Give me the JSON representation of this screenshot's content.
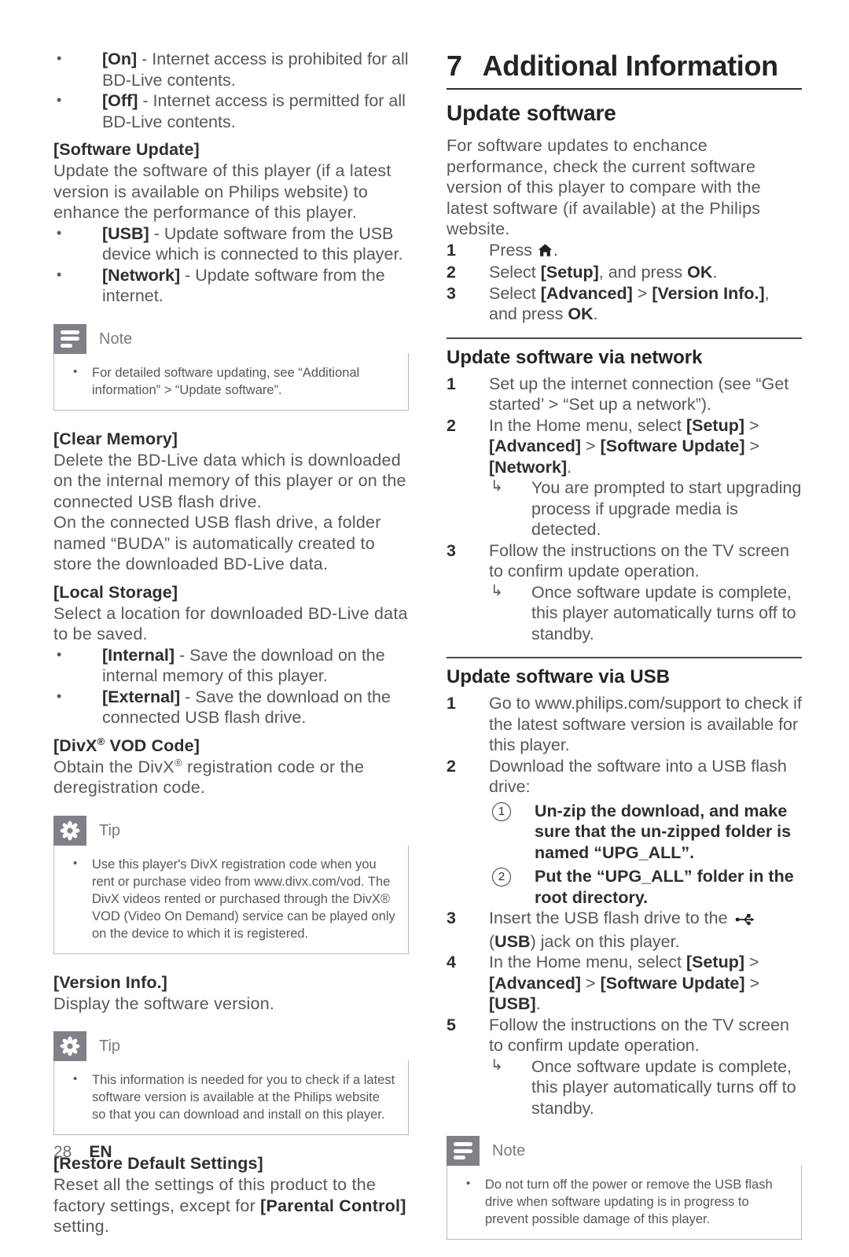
{
  "page": {
    "number": "28",
    "language": "EN"
  },
  "left_column": {
    "bd_live_options": [
      {
        "key": "[On]",
        "text": " - Internet access is prohibited for all BD-Live contents."
      },
      {
        "key": "[Off]",
        "text": " - Internet access is permitted for all BD-Live contents."
      }
    ],
    "software_update": {
      "heading": "[Software Update]",
      "body": "Update the software of this player (if a latest version is available on Philips website) to enhance the performance of this player.",
      "options": [
        {
          "key": "[USB]",
          "text": " - Update software from the USB device which is connected to this player."
        },
        {
          "key": "[Network]",
          "text": " - Update software from the internet."
        }
      ]
    },
    "note1": {
      "title": "Note",
      "icon": "note-lines-icon",
      "items": [
        "For detailed software updating, see “Additional information” > “Update software”."
      ]
    },
    "clear_memory": {
      "heading": "[Clear Memory]",
      "paragraph1": "Delete the BD-Live data which is downloaded on the internal memory of this player or on the connected USB flash drive.",
      "paragraph2": "On the connected USB flash drive, a folder named “BUDA” is automatically created to store the downloaded BD-Live data."
    },
    "local_storage": {
      "heading": "[Local Storage]",
      "body": "Select a location for downloaded BD-Live data to be saved.",
      "options": [
        {
          "key": "[Internal]",
          "text": " - Save the download on the internal memory of this player."
        },
        {
          "key": "[External]",
          "text": " - Save the download on the connected USB flash drive."
        }
      ]
    },
    "divx_vod": {
      "heading_pre": "[DivX",
      "heading_reg": "®",
      "heading_post": " VOD Code]",
      "body_pre": "Obtain the DivX",
      "body_reg": "®",
      "body_post": " registration code or the deregistration code."
    },
    "tip1": {
      "title": "Tip",
      "icon": "tip-asterisk-icon",
      "items": [
        "Use this player's DivX registration code when you rent or purchase video from www.divx.com/vod. The DivX videos rented or purchased through the DivX® VOD (Video On Demand) service can be played only on the device to which it is registered."
      ]
    },
    "version_info": {
      "heading": "[Version Info.]",
      "body": "Display the software version."
    },
    "tip2": {
      "title": "Tip",
      "icon": "tip-asterisk-icon",
      "items": [
        "This information is needed for you to check if a latest software version is available at the Philips website so that you can download and install on this player."
      ]
    },
    "restore_defaults": {
      "heading": "[Restore Default Settings]",
      "body_pre": "Reset all the settings of this product to the factory settings, except for ",
      "body_bold": "[Parental Control]",
      "body_post": " setting."
    }
  },
  "right_column": {
    "chapter": {
      "number": "7",
      "title": "Additional Information"
    },
    "update_software": {
      "heading": "Update software",
      "intro": "For software updates to enchance performance, check the current software version of this player to compare with the latest software (if available) at the Philips website.",
      "steps": [
        {
          "num": "1",
          "pre": "Press ",
          "icon": "home-icon",
          "post": "."
        },
        {
          "num": "2",
          "pre": "Select ",
          "bold1": "[Setup]",
          "mid": ", and press ",
          "bold2": "OK",
          "post": "."
        },
        {
          "num": "3",
          "pre": "Select ",
          "bold1": "[Advanced]",
          "mid": " > ",
          "bold2": "[Version Info.]",
          "mid2": ", and press ",
          "bold3": "OK",
          "post": "."
        }
      ]
    },
    "via_network": {
      "heading": "Update software via network",
      "steps": [
        {
          "num": "1",
          "text": "Set up the internet connection (see “Get started’ > “Set up a network”)."
        },
        {
          "num": "2",
          "pre": "In the Home menu, select ",
          "bold1": "[Setup]",
          "sep1": " > ",
          "bold2": "[Advanced]",
          "sep2": " > ",
          "bold3": "[Software Update]",
          "sep3": " > ",
          "bold4": "[Network]",
          "post": ".",
          "result": "You are prompted to start upgrading process if upgrade media is detected."
        },
        {
          "num": "3",
          "text": "Follow the instructions on the TV screen to confirm update operation.",
          "result": "Once software update is complete, this player automatically turns off to standby."
        }
      ]
    },
    "via_usb": {
      "heading": "Update software via USB",
      "steps": [
        {
          "num": "1",
          "text": "Go to www.philips.com/support to check if the latest software version is available for this player."
        },
        {
          "num": "2",
          "text": "Download the software into a USB flash drive:",
          "substeps": [
            {
              "marker": "1",
              "text": "Un-zip the download, and make sure that the un-zipped folder is named “UPG_ALL”."
            },
            {
              "marker": "2",
              "text": "Put the “UPG_ALL” folder in the root directory."
            }
          ]
        },
        {
          "num": "3",
          "pre": "Insert the USB flash drive to the ",
          "icon": "usb-icon",
          "mid": " (",
          "bold1": "USB",
          "post": ") jack on this player."
        },
        {
          "num": "4",
          "pre": "In the Home menu, select ",
          "bold1": "[Setup]",
          "sep1": " > ",
          "bold2": "[Advanced]",
          "sep2": " > ",
          "bold3": "[Software Update]",
          "sep3": " > ",
          "bold4": "[USB]",
          "post": "."
        },
        {
          "num": "5",
          "text": "Follow the instructions on the TV screen to confirm update operation.",
          "result": "Once software update is complete, this player automatically turns off to standby."
        }
      ]
    },
    "note2": {
      "title": "Note",
      "icon": "note-lines-icon",
      "items": [
        "Do not turn off the power or remove the USB flash drive when software updating is in progress to prevent possible damage of this player."
      ]
    }
  },
  "colors": {
    "callout_icon_bg": "#808088",
    "callout_border": "#b9b9c2",
    "body_text": "#57575c",
    "heading_text": "#232328"
  }
}
